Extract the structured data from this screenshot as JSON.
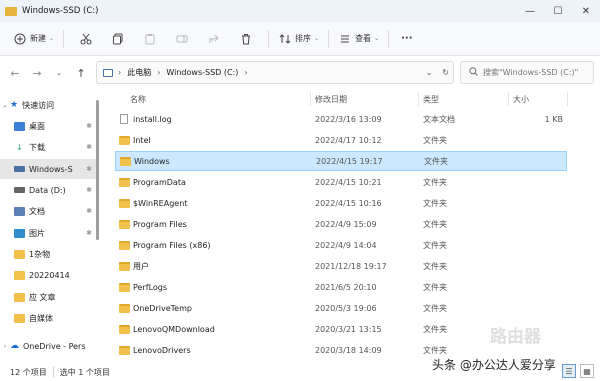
{
  "window": {
    "title": "Windows-SSD (C:)",
    "minimize": "—",
    "maximize": "☐",
    "close": "✕"
  },
  "toolbar": {
    "new_label": "新建",
    "sort_label": "排序",
    "view_label": "查看",
    "more_label": "···"
  },
  "address": {
    "crumbs": [
      "此电脑",
      "Windows-SSD (C:)"
    ],
    "search_placeholder": "搜索\"Windows-SSD (C:)\""
  },
  "sidebar": {
    "items": [
      {
        "label": "快速访问",
        "icon": "star-icon",
        "color": "#1d6fd8"
      },
      {
        "label": "桌面",
        "icon": "desktop-icon",
        "color": "#3a7fd4"
      },
      {
        "label": "下载",
        "icon": "download-icon",
        "color": "#2ea36b"
      },
      {
        "label": "Windows-S",
        "icon": "drive-icon",
        "color": "#4a6fa5"
      },
      {
        "label": "Data (D:)",
        "icon": "drive-icon",
        "color": "#666666"
      },
      {
        "label": "文档",
        "icon": "document-icon",
        "color": "#5b7fb3"
      },
      {
        "label": "图片",
        "icon": "picture-icon",
        "color": "#2f8fcc"
      },
      {
        "label": "1杂物",
        "icon": "folder-icon",
        "color": "#f2c14b"
      },
      {
        "label": "20220414",
        "icon": "folder-icon",
        "color": "#f2c14b"
      },
      {
        "label": "应 文章",
        "icon": "folder-icon",
        "color": "#f2c14b"
      },
      {
        "label": "自媒体",
        "icon": "folder-icon",
        "color": "#f2c14b"
      },
      {
        "label": "OneDrive - Pers",
        "icon": "cloud-icon",
        "color": "#1d6fd8"
      }
    ]
  },
  "columns": {
    "name": "名称",
    "date": "修改日期",
    "type": "类型",
    "size": "大小"
  },
  "files": [
    {
      "name": "install.log",
      "date": "2022/3/16 13:09",
      "type": "文本文档",
      "size": "1 KB",
      "kind": "file"
    },
    {
      "name": "Intel",
      "date": "2022/4/17 10:12",
      "type": "文件夹",
      "size": "",
      "kind": "folder"
    },
    {
      "name": "Windows",
      "date": "2022/4/15 19:17",
      "type": "文件夹",
      "size": "",
      "kind": "folder"
    },
    {
      "name": "ProgramData",
      "date": "2022/4/15 10:21",
      "type": "文件夹",
      "size": "",
      "kind": "folder"
    },
    {
      "name": "$WinREAgent",
      "date": "2022/4/15 10:16",
      "type": "文件夹",
      "size": "",
      "kind": "folder"
    },
    {
      "name": "Program Files",
      "date": "2022/4/9 15:09",
      "type": "文件夹",
      "size": "",
      "kind": "folder"
    },
    {
      "name": "Program Files (x86)",
      "date": "2022/4/9 14:04",
      "type": "文件夹",
      "size": "",
      "kind": "folder"
    },
    {
      "name": "用户",
      "date": "2021/12/18 19:17",
      "type": "文件夹",
      "size": "",
      "kind": "folder"
    },
    {
      "name": "PerfLogs",
      "date": "2021/6/5 20:10",
      "type": "文件夹",
      "size": "",
      "kind": "folder"
    },
    {
      "name": "OneDriveTemp",
      "date": "2020/5/3 19:06",
      "type": "文件夹",
      "size": "",
      "kind": "folder"
    },
    {
      "name": "LenovoQMDownload",
      "date": "2020/3/21 13:15",
      "type": "文件夹",
      "size": "",
      "kind": "folder"
    },
    {
      "name": "LenovoDrivers",
      "date": "2020/3/18 14:09",
      "type": "文件夹",
      "size": "",
      "kind": "folder"
    }
  ],
  "status": {
    "count": "12 个项目",
    "selected": "选中 1 个项目"
  },
  "watermark": {
    "brand": "路由器",
    "credit": "头条 @办公达人爱分享"
  },
  "colors": {
    "accent": "#1d6fd8",
    "selection": "#cce8ff",
    "folder": "#f2c14b"
  }
}
